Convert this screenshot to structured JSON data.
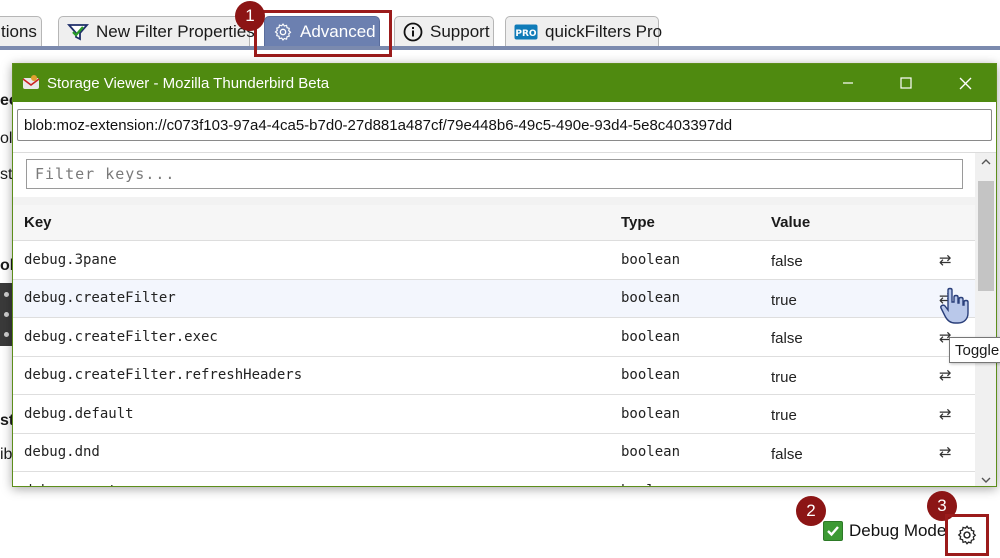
{
  "tabs": [
    {
      "label": "tions",
      "icon": "none"
    },
    {
      "label": "New Filter Properties",
      "icon": "filter-check-icon"
    },
    {
      "label": "Advanced",
      "icon": "gear-icon",
      "active": true
    },
    {
      "label": "Support",
      "icon": "info-icon"
    },
    {
      "label": "quickFilters Pro",
      "icon": "pro-badge-icon"
    }
  ],
  "badges": [
    "1",
    "2",
    "3"
  ],
  "background_fragments": [
    "ec",
    "oly",
    "sto",
    "ol",
    "st",
    "ib"
  ],
  "window": {
    "title": "Storage Viewer - Mozilla Thunderbird Beta",
    "url": "blob:moz-extension://c073f103-97a4-4ca5-b7d0-27d881a487cf/79e448b6-49c5-490e-93d4-5e8c403397dd",
    "filter_placeholder": "Filter keys...",
    "columns": [
      "Key",
      "Type",
      "Value"
    ],
    "toggle_symbol": "⇄",
    "rows": [
      {
        "key": "debug.3pane",
        "type": "boolean",
        "value": "false"
      },
      {
        "key": "debug.createFilter",
        "type": "boolean",
        "value": "true"
      },
      {
        "key": "debug.createFilter.exec",
        "type": "boolean",
        "value": "false"
      },
      {
        "key": "debug.createFilter.refreshHeaders",
        "type": "boolean",
        "value": "true"
      },
      {
        "key": "debug.default",
        "type": "boolean",
        "value": "true"
      },
      {
        "key": "debug.dnd",
        "type": "boolean",
        "value": "false"
      },
      {
        "key": "debug.events",
        "type": "boolean",
        "value": "false"
      }
    ]
  },
  "tooltip": "Toggle",
  "debug_mode": {
    "label": "Debug Mode",
    "checked": true
  },
  "colors": {
    "accent": "#6c80b0",
    "titlebar": "#4f8a10",
    "badge": "#8c1515",
    "checkbox": "#3c9a34"
  }
}
